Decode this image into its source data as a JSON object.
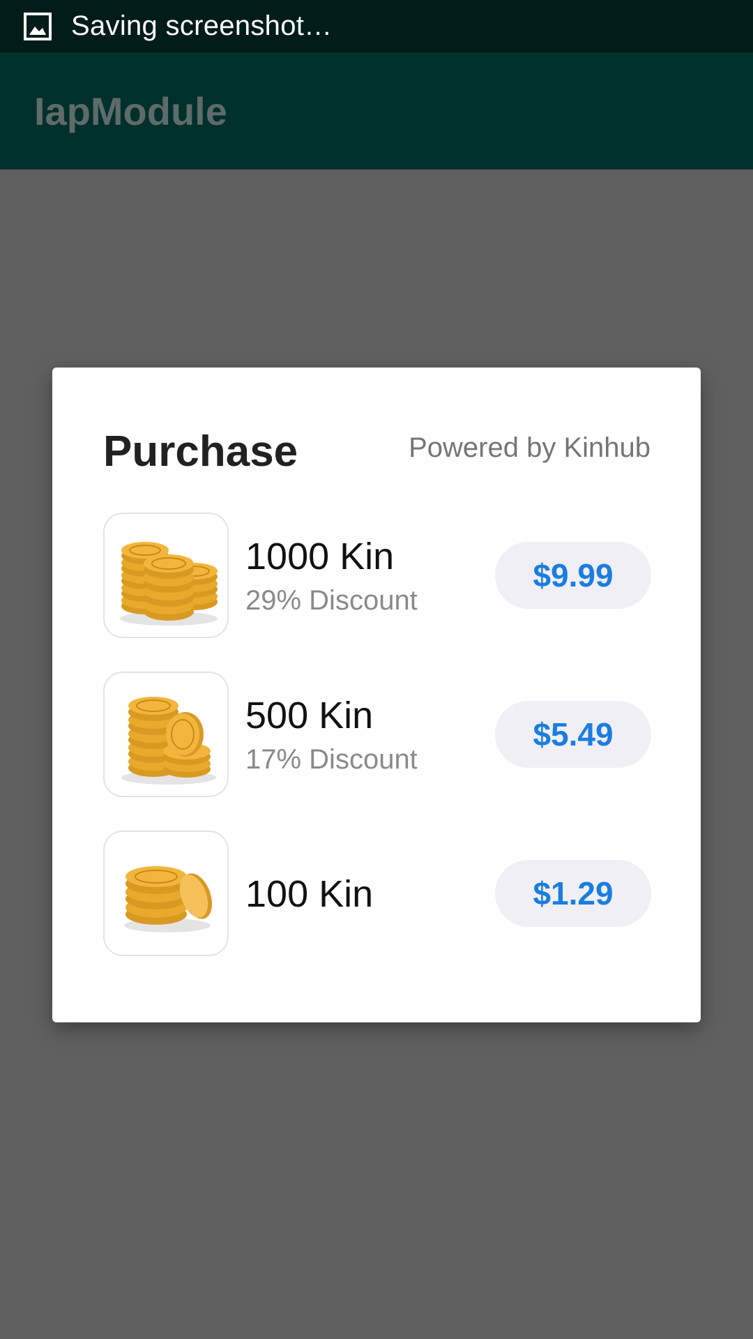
{
  "status_bar": {
    "icon": "screenshot-icon",
    "text": "Saving screenshot…"
  },
  "app_bar": {
    "title": "IapModule"
  },
  "dialog": {
    "title": "Purchase",
    "powered_by": "Powered by Kinhub",
    "items": [
      {
        "name": "1000 Kin",
        "discount": "29% Discount",
        "price": "$9.99",
        "icon": "coin-stack-large-icon"
      },
      {
        "name": "500 Kin",
        "discount": "17% Discount",
        "price": "$5.49",
        "icon": "coin-stack-medium-icon"
      },
      {
        "name": "100 Kin",
        "discount": "",
        "price": "$1.29",
        "icon": "coin-stack-small-icon"
      }
    ]
  },
  "colors": {
    "status_bar_bg": "#021c1a",
    "app_bar_bg": "#00302c",
    "scrim": "#606060",
    "price_text": "#1b7de0",
    "price_button_bg": "#efeff5",
    "coin_gold": "#f2b63c"
  }
}
